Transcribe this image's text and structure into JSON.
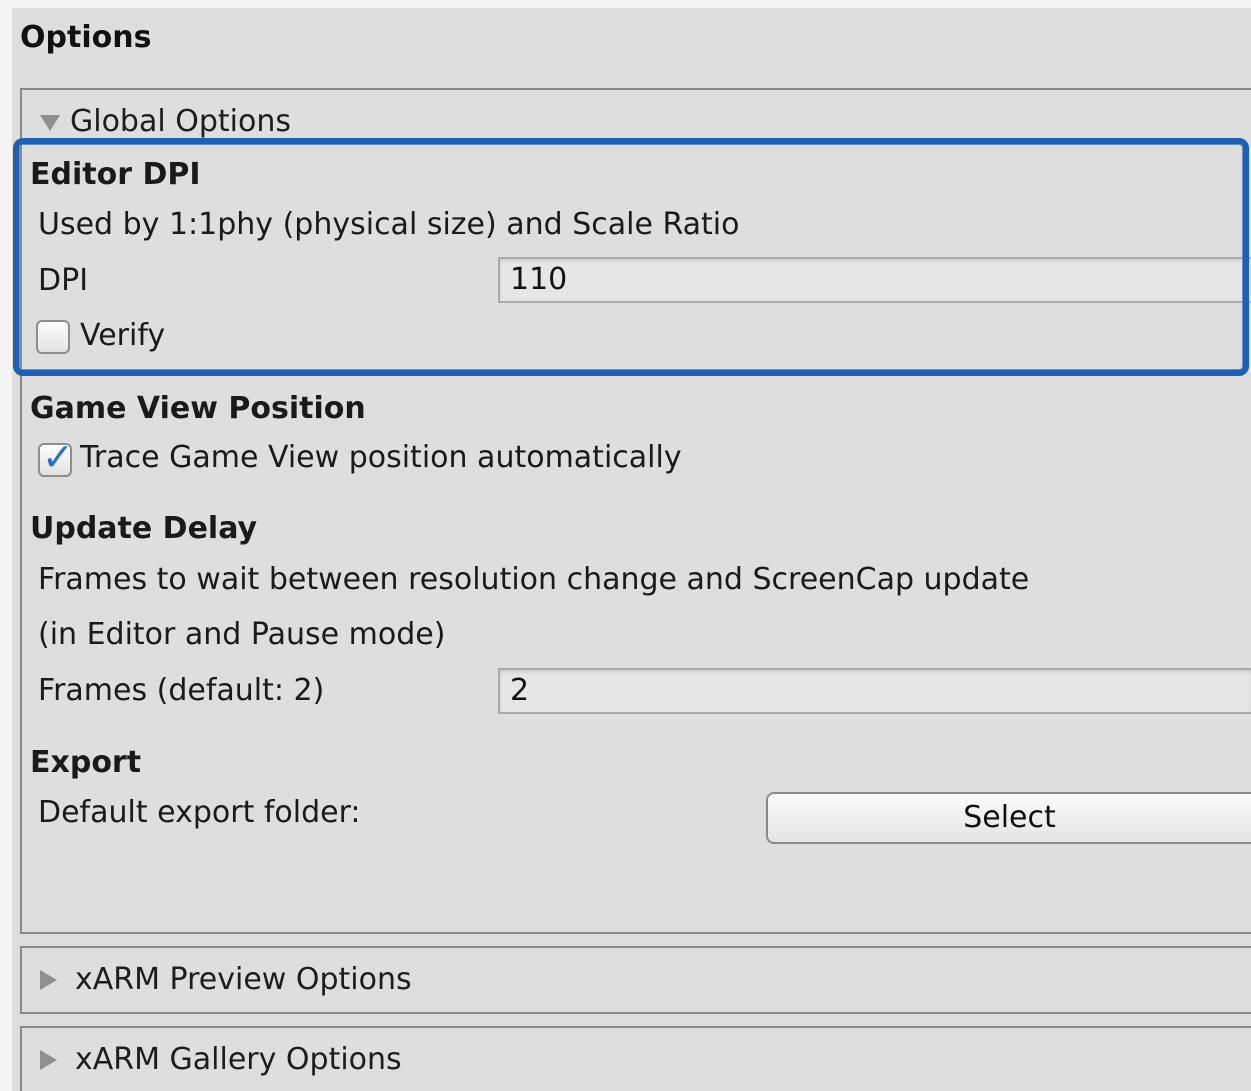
{
  "header": {
    "title": "Options"
  },
  "global": {
    "label": "Global Options",
    "editor_dpi": {
      "heading": "Editor DPI",
      "description": "Used by 1:1phy (physical size) and Scale Ratio",
      "dpi_label": "DPI",
      "dpi_value": "110",
      "verify_label": "Verify",
      "verify_checked": false
    },
    "game_view": {
      "heading": "Game View Position",
      "trace_label": "Trace Game View position automatically",
      "trace_checked": true
    },
    "update_delay": {
      "heading": "Update Delay",
      "line1": "Frames to wait between resolution change and ScreenCap update",
      "line2": "(in Editor and Pause mode)",
      "frames_label": "Frames (default: 2)",
      "frames_value": "2"
    },
    "export": {
      "heading": "Export",
      "folder_label": "Default export folder:",
      "select_label": "Select"
    }
  },
  "sections": {
    "preview_label": "xARM Preview Options",
    "gallery_label": "xARM Gallery Options"
  },
  "colors": {
    "highlight": "#1f5fb4",
    "checkmark": "#2c6fc9",
    "panel_bg": "#dedede"
  }
}
